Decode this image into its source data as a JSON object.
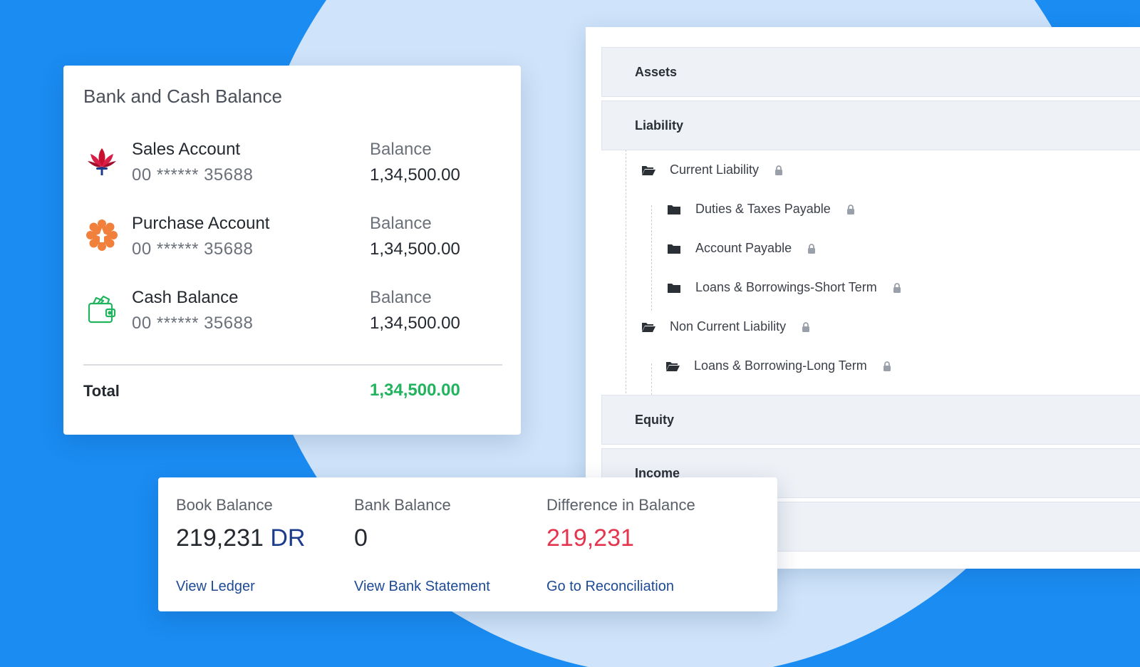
{
  "coa": {
    "sections": {
      "assets": "Assets",
      "liability": "Liability",
      "equity": "Equity",
      "income": "Income"
    },
    "tree": {
      "current_liability": "Current Liability",
      "duties_taxes": "Duties & Taxes Payable",
      "account_payable": "Account Payable",
      "loans_short": "Loans & Borrowings-Short Term",
      "non_current_liability": "Non Current Liability",
      "loans_long": "Loans & Borrowing-Long Term"
    }
  },
  "bank_card": {
    "title": "Bank and Cash Balance",
    "accounts": [
      {
        "name": "Sales Account",
        "number": "00 ****** 35688",
        "balance_label": "Balance",
        "balance": "1,34,500.00",
        "icon": "lotus-icon"
      },
      {
        "name": "Purchase Account",
        "number": "00 ****** 35688",
        "balance_label": "Balance",
        "balance": "1,34,500.00",
        "icon": "orange-emblem-icon"
      },
      {
        "name": "Cash Balance",
        "number": "00 ****** 35688",
        "balance_label": "Balance",
        "balance": "1,34,500.00",
        "icon": "wallet-icon"
      }
    ],
    "total_label": "Total",
    "total_value": "1,34,500.00"
  },
  "recon_card": {
    "book_balance_label": "Book Balance",
    "book_balance_value": "219,231",
    "book_balance_suffix": "DR",
    "bank_balance_label": "Bank Balance",
    "bank_balance_value": "0",
    "difference_label": "Difference in Balance",
    "difference_value": "219,231",
    "view_ledger": "View Ledger",
    "view_bank_statement": "View Bank Statement",
    "go_to_reconciliation": "Go to Reconciliation"
  },
  "colors": {
    "background": "#1a8cf2",
    "total_green": "#22b35e",
    "difference_red": "#e5354e",
    "link_blue": "#1d4a95",
    "dr_blue": "#1b3c8c"
  }
}
